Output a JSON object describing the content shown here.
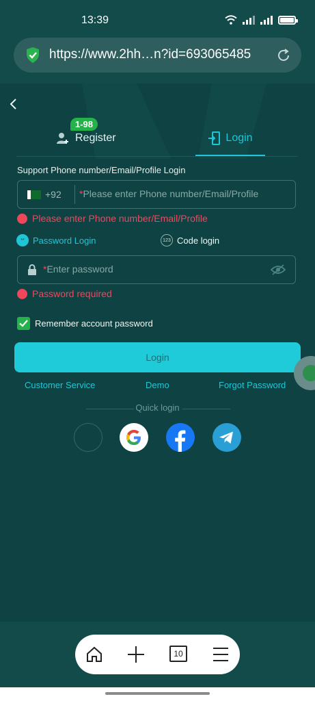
{
  "status": {
    "time": "13:39"
  },
  "browser": {
    "url": "https://www.2hh…n?id=693065485",
    "tab_count": "10"
  },
  "tabs": [
    {
      "label": "Register",
      "badge": "1-98"
    },
    {
      "label": "Login"
    }
  ],
  "form": {
    "support_label": "Support Phone number/Email/Profile Login",
    "country_code": "+92",
    "phone_placeholder": "Please enter Phone number/Email/Profile",
    "phone_error": "Please enter Phone number/Email/Profile",
    "mode_password": "Password Login",
    "mode_code": "Code login",
    "mode_code_icon": "123",
    "password_placeholder": "Enter password",
    "password_error": "Password required",
    "remember_label": "Remember account password",
    "remember_checked": true,
    "login_button": "Login"
  },
  "links": {
    "customer_service": "Customer Service",
    "demo": "Demo",
    "forgot_password": "Forgot Password"
  },
  "quick_login": {
    "label": "Quick login",
    "providers": [
      "google",
      "facebook",
      "telegram"
    ]
  },
  "colors": {
    "accent": "#1fc7d6",
    "error": "#f0465b",
    "success": "#26b24a",
    "background": "#0f4343"
  }
}
